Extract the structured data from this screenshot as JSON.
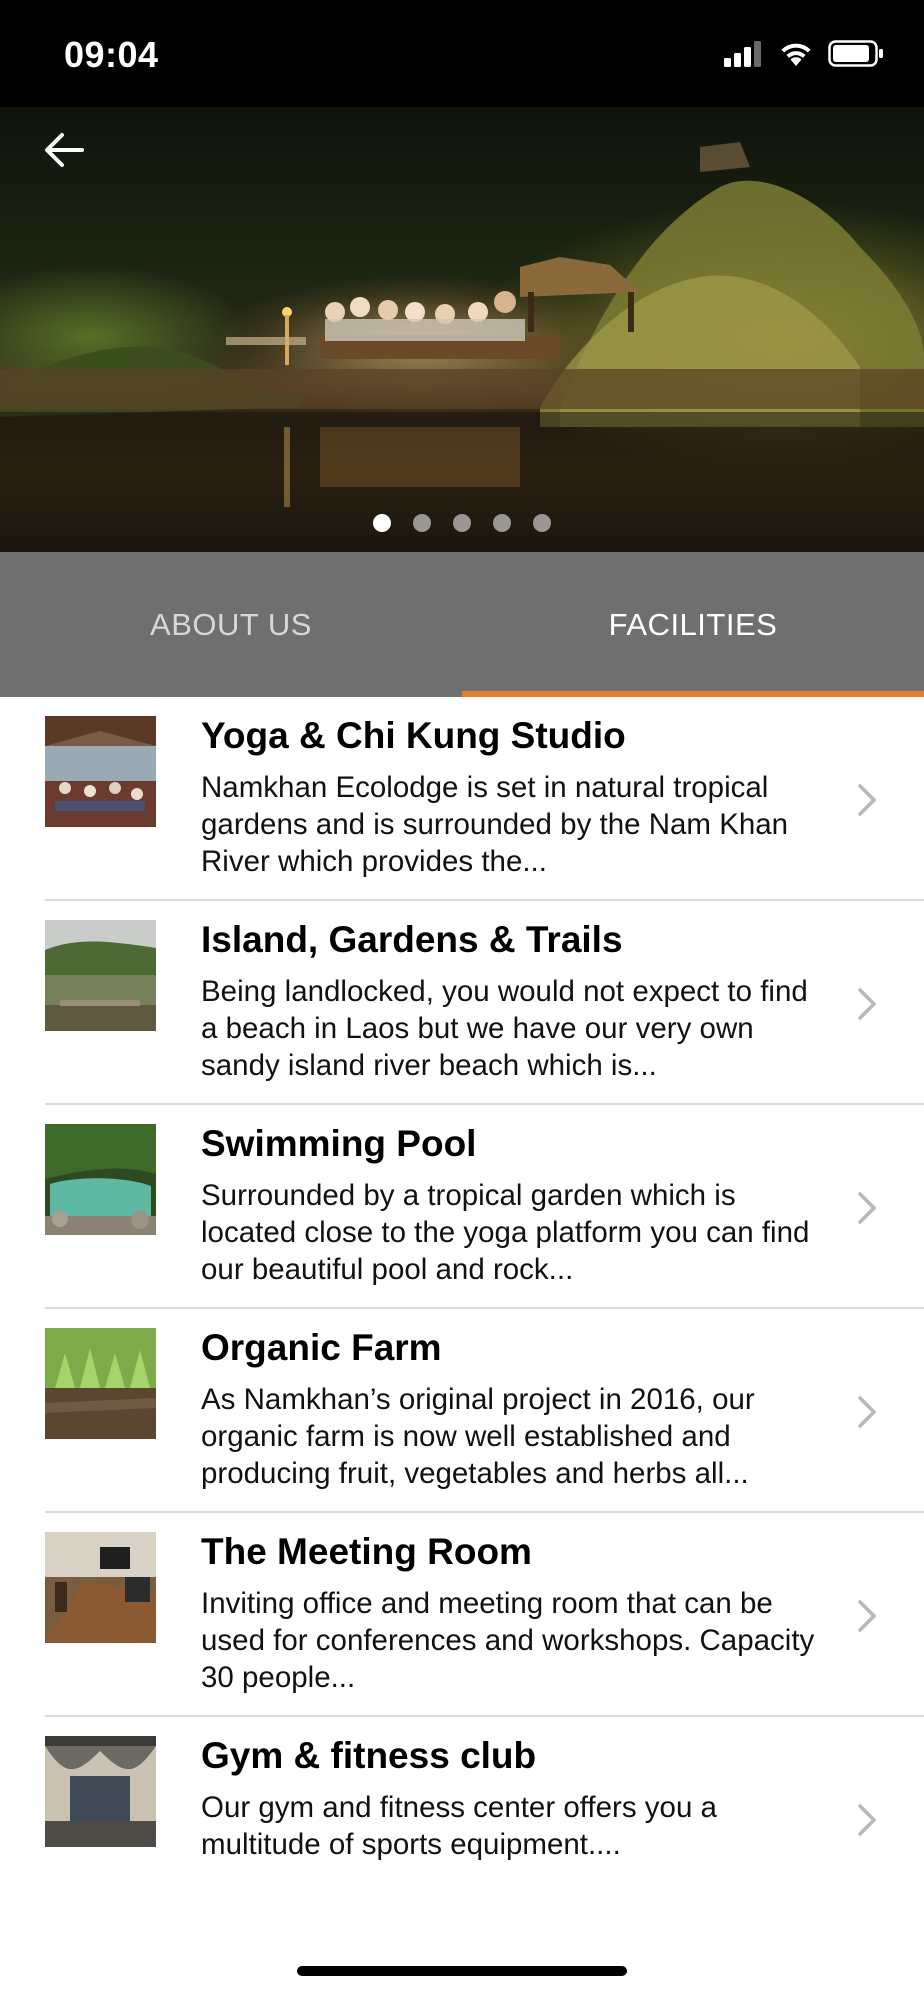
{
  "status_bar": {
    "time": "09:04"
  },
  "tabs": [
    {
      "label": "ABOUT US"
    },
    {
      "label": "FACILITIES"
    }
  ],
  "active_tab": "FACILITIES",
  "carousel": {
    "dot_count": 5,
    "active_index": 0
  },
  "colors": {
    "accent": "#e57f2e",
    "tab_bar": "#6f6f6f",
    "separator": "#dcdcdc",
    "chevron": "#b8b8b8"
  },
  "facilities": [
    {
      "title": "Yoga & Chi Kung Studio",
      "desc": "Namkhan Ecolodge is set in natural tropical gardens and is surrounded by the Nam Khan River which provides the..."
    },
    {
      "title": "Island, Gardens & Trails",
      "desc": "Being landlocked, you would not expect to find a beach in Laos but we have our very own sandy island river beach which is..."
    },
    {
      "title": "Swimming Pool",
      "desc": "Surrounded by a tropical garden which is located close to the yoga platform you can find our beautiful pool and rock..."
    },
    {
      "title": "Organic Farm",
      "desc": "As Namkhan’s original project in 2016, our organic farm is now well established and producing fruit, vegetables and herbs all..."
    },
    {
      "title": "The Meeting Room",
      "desc": "Inviting office and meeting room that can be used for conferences and workshops. Capacity 30 people..."
    },
    {
      "title": "Gym & fitness club",
      "desc": "Our gym and fitness center offers you a multitude of sports equipment...."
    }
  ]
}
